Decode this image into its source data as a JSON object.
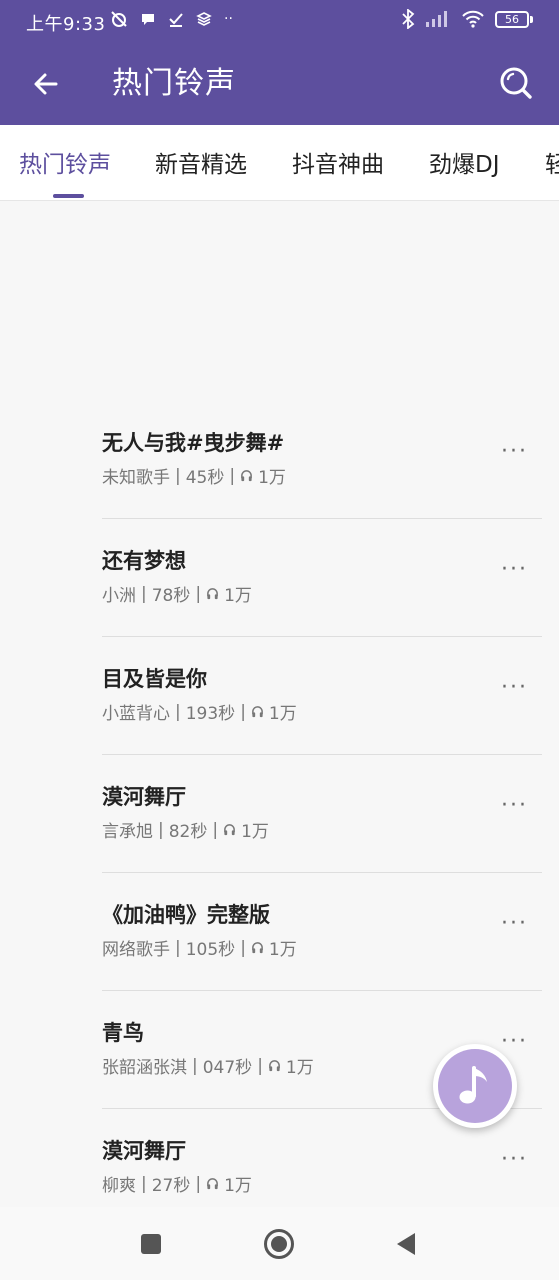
{
  "status_bar": {
    "time": "上午9:33",
    "battery": "56",
    "icons_left": [
      "muted-alarm-icon",
      "chat-bubble-icon",
      "check-icon",
      "layers-icon",
      "more-dots-icon"
    ],
    "icons_right": [
      "bluetooth-icon",
      "signal-icon",
      "wifi-icon",
      "battery-icon"
    ]
  },
  "toolbar": {
    "title": "热门铃声",
    "back_icon": "arrow-left-icon",
    "search_icon": "search-icon"
  },
  "tabs": [
    {
      "label": "热门铃声",
      "active": true
    },
    {
      "label": "新音精选",
      "active": false
    },
    {
      "label": "抖音神曲",
      "active": false
    },
    {
      "label": "劲爆DJ",
      "active": false
    },
    {
      "label": "轻",
      "active": false
    }
  ],
  "ringtones": [
    {
      "title": "无人与我#曳步舞#",
      "artist": "未知歌手",
      "duration": "45秒",
      "plays": "1万"
    },
    {
      "title": "还有梦想",
      "artist": "小洲",
      "duration": "78秒",
      "plays": "1万"
    },
    {
      "title": "目及皆是你",
      "artist": "小蓝背心",
      "duration": "193秒",
      "plays": "1万"
    },
    {
      "title": "漠河舞厅",
      "artist": "言承旭",
      "duration": "82秒",
      "plays": "1万"
    },
    {
      "title": "《加油鸭》完整版",
      "artist": "网络歌手",
      "duration": "105秒",
      "plays": "1万"
    },
    {
      "title": "青鸟",
      "artist": "张韶涵张淇",
      "duration": "047秒",
      "plays": "1万"
    },
    {
      "title": "漠河舞厅",
      "artist": "柳爽",
      "duration": "27秒",
      "plays": "1万"
    }
  ],
  "meta_separator": "|",
  "more_label": "···",
  "fab_icon": "music-note-icon",
  "nav": [
    "recents-square-icon",
    "home-circle-icon",
    "back-triangle-icon"
  ],
  "colors": {
    "primary": "#5d4f9e",
    "fab": "#b8a3dc"
  }
}
